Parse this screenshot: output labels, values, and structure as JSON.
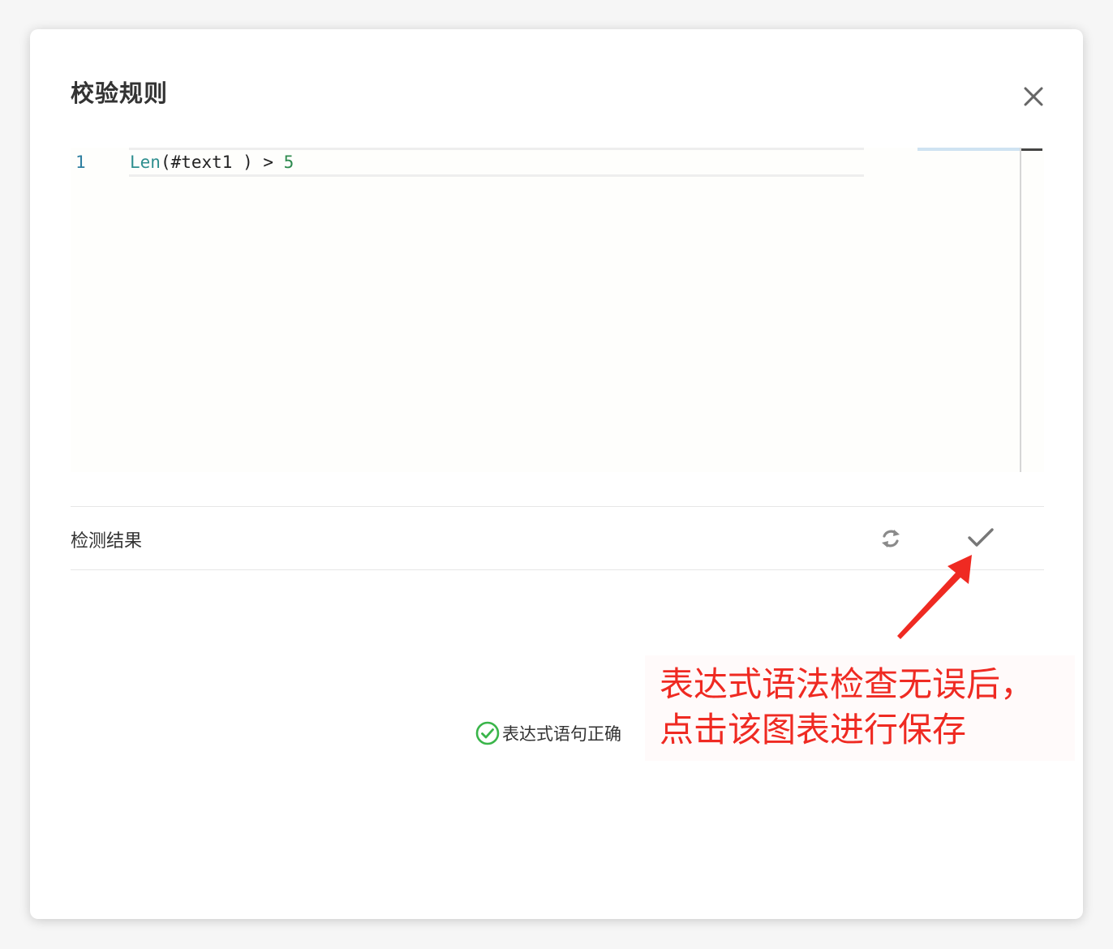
{
  "dialog": {
    "title": "校验规则",
    "close_icon": "close-icon"
  },
  "editor": {
    "line_number": "1",
    "code": {
      "fn": "Len",
      "rest": "(#text1 ) > ",
      "num": "5"
    }
  },
  "result": {
    "label": "检测结果",
    "refresh_icon": "refresh-icon",
    "save_icon": "check-icon",
    "status_text": "表达式语句正确",
    "status_color": "#3ab54a"
  },
  "annotation": {
    "line1": "表达式语法检查无误后，",
    "line2": "点击该图表进行保存",
    "color": "#ef2a22"
  }
}
